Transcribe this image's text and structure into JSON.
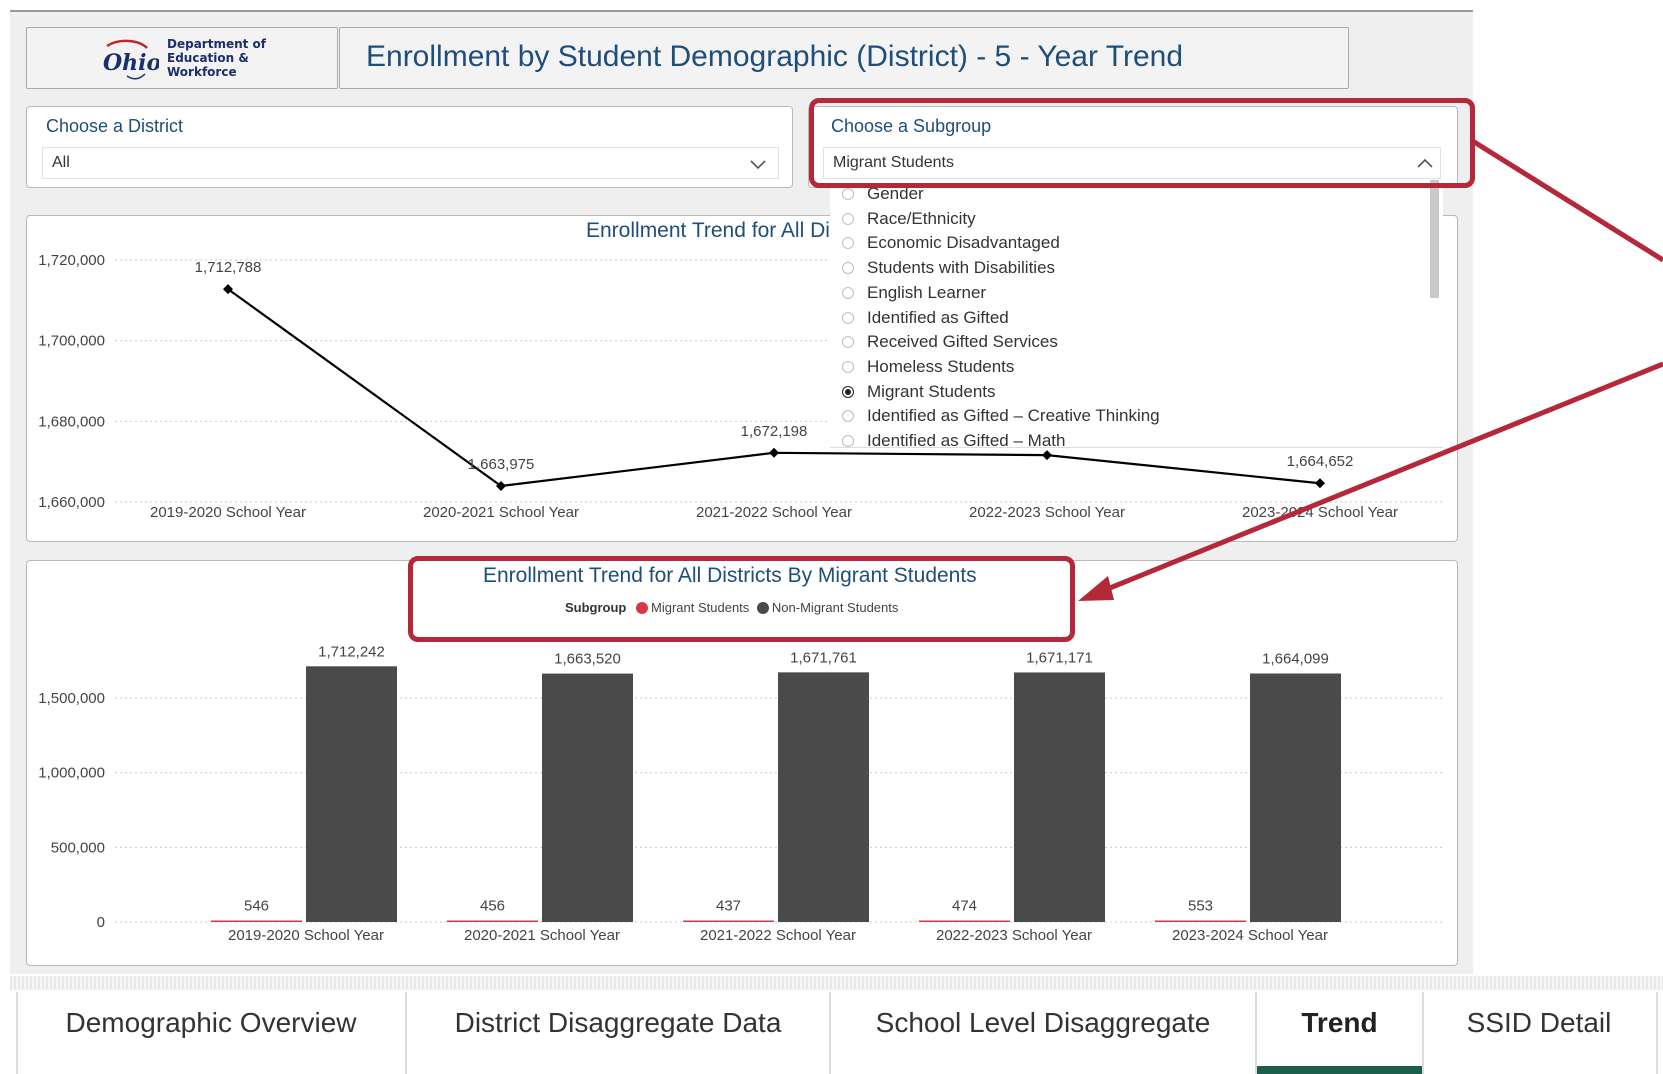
{
  "header": {
    "logo_lines": [
      "Department of",
      "Education &",
      "Workforce"
    ],
    "logo_word": "Ohio",
    "title": "Enrollment by Student Demographic (District) - 5 - Year Trend"
  },
  "district_slicer": {
    "label": "Choose a District",
    "value": "All"
  },
  "subgroup_slicer": {
    "label": "Choose a Subgroup",
    "value": "Migrant Students",
    "options": [
      {
        "label": "Gender",
        "selected": false
      },
      {
        "label": "Race/Ethnicity",
        "selected": false
      },
      {
        "label": "Economic Disadvantaged",
        "selected": false
      },
      {
        "label": "Students with Disabilities",
        "selected": false
      },
      {
        "label": "English Learner",
        "selected": false
      },
      {
        "label": "Identified as Gifted",
        "selected": false
      },
      {
        "label": "Received Gifted Services",
        "selected": false
      },
      {
        "label": "Homeless Students",
        "selected": false
      },
      {
        "label": "Migrant Students",
        "selected": true
      },
      {
        "label": "Identified as Gifted – Creative Thinking",
        "selected": false
      },
      {
        "label": "Identified as Gifted – Math",
        "selected": false
      }
    ]
  },
  "chart_data": [
    {
      "type": "line",
      "title": "Enrollment Trend for All Districts",
      "categories": [
        "2019-2020 School Year",
        "2020-2021 School Year",
        "2021-2022 School Year",
        "2022-2023 School Year",
        "2023-2024 School Year"
      ],
      "values": [
        1712788,
        1663975,
        1672198,
        1671613,
        1664652
      ],
      "data_labels": [
        "1,712,788",
        "1,663,975",
        "1,672,198",
        "",
        "1,664,652"
      ],
      "yticks": [
        "1,660,000",
        "1,680,000",
        "1,700,000",
        "1,720,000"
      ],
      "ylim": [
        1660000,
        1720000
      ],
      "grid": true,
      "color": "#000000"
    },
    {
      "type": "bar",
      "title": "Enrollment Trend for All Districts By Migrant Students",
      "legend_title": "Subgroup",
      "categories": [
        "2019-2020 School Year",
        "2020-2021 School Year",
        "2021-2022 School Year",
        "2022-2023 School Year",
        "2023-2024 School Year"
      ],
      "series": [
        {
          "name": "Migrant Students",
          "color": "#d13a4a",
          "values": [
            546,
            456,
            437,
            474,
            553
          ],
          "labels": [
            "546",
            "456",
            "437",
            "474",
            "553"
          ]
        },
        {
          "name": "Non-Migrant Students",
          "color": "#4a4a4a",
          "values": [
            1712242,
            1663520,
            1671761,
            1671171,
            1664099
          ],
          "labels": [
            "1,712,242",
            "1,663,520",
            "1,671,761",
            "1,671,171",
            "1,664,099"
          ]
        }
      ],
      "yticks": [
        "0",
        "500,000",
        "1,000,000",
        "1,500,000"
      ],
      "ylim": [
        0,
        1700000
      ],
      "grid": true,
      "legend_position": "top-center"
    }
  ],
  "tabs": [
    {
      "label": "Demographic Overview",
      "active": false
    },
    {
      "label": "District Disaggregate Data",
      "active": false
    },
    {
      "label": "School Level Disaggregate",
      "active": false
    },
    {
      "label": "Trend",
      "active": true
    },
    {
      "label": "SSID Detail",
      "active": false
    }
  ],
  "colors": {
    "accent": "#1f4e79",
    "highlight": "#b5283a",
    "tab_active": "#1b5e4c"
  }
}
